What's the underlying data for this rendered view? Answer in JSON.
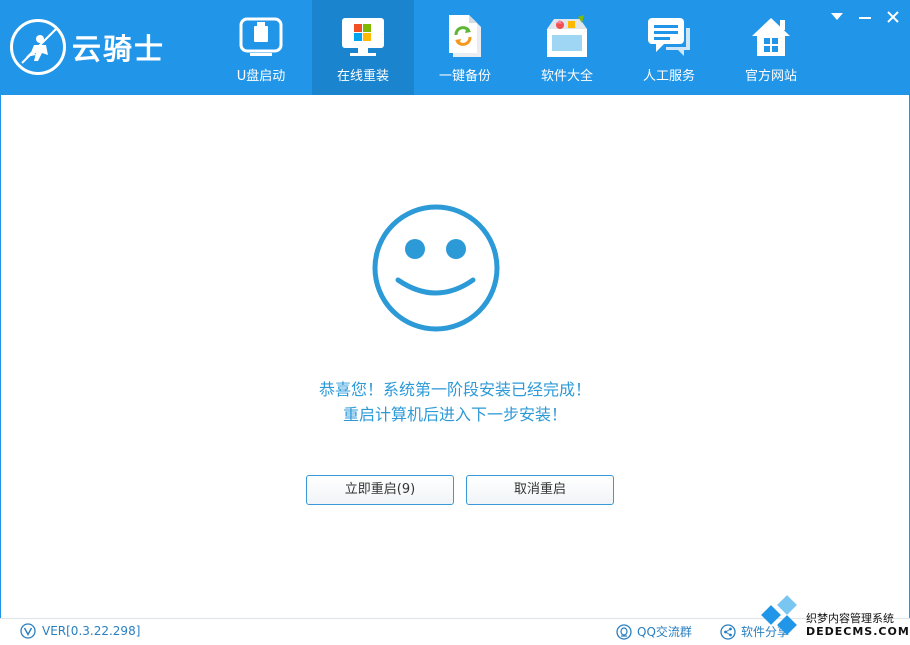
{
  "app": {
    "logo_text": "云骑士"
  },
  "nav": {
    "items": [
      {
        "label": "U盘启动",
        "icon": "usb-drive-icon"
      },
      {
        "label": "在线重装",
        "icon": "windows-monitor-icon"
      },
      {
        "label": "一键备份",
        "icon": "backup-document-icon"
      },
      {
        "label": "软件大全",
        "icon": "software-box-icon"
      },
      {
        "label": "人工服务",
        "icon": "chat-bubble-icon"
      },
      {
        "label": "官方网站",
        "icon": "home-icon"
      }
    ],
    "active_index": 1
  },
  "main": {
    "message_line1": "恭喜您！系统第一阶段安装已经完成！",
    "message_line2": "重启计算机后进入下一步安装！",
    "restart_button": "立即重启(9)",
    "cancel_button": "取消重启"
  },
  "footer": {
    "version": "VER[0.3.22.298]",
    "qq_group": "QQ交流群",
    "share": "软件分享"
  },
  "watermark": {
    "line1": "织梦内容管理系统",
    "line2": "DEDECMS.COM"
  },
  "colors": {
    "header_bg": "#2196e8",
    "active_tab_bg": "#1b84cf",
    "accent": "#2d9ad8"
  }
}
